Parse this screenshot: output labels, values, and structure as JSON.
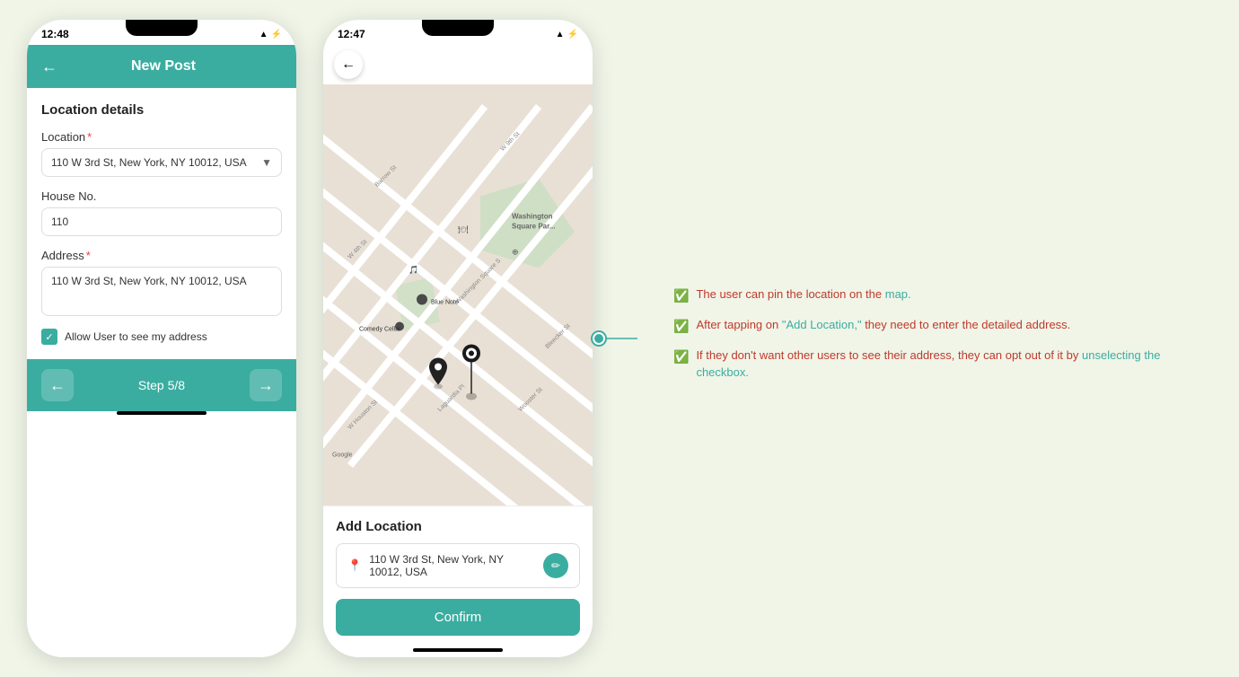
{
  "left_phone": {
    "time": "12:48",
    "header": {
      "back_label": "←",
      "title": "New Post"
    },
    "section_title": "Location details",
    "form": {
      "location_label": "Location",
      "location_value": "110 W 3rd St, New York, NY 10012, USA",
      "house_no_label": "House No.",
      "house_no_value": "110",
      "address_label": "Address",
      "address_value": "110 W 3rd St, New York, NY 10012, USA",
      "checkbox_label": "Allow User to see my address"
    },
    "footer": {
      "back_icon": "←",
      "step_label": "Step 5/8",
      "next_icon": "→"
    }
  },
  "right_phone": {
    "time": "12:47",
    "add_location": {
      "title": "Add Location",
      "address": "110 W 3rd St, New York, NY 10012, USA",
      "confirm_label": "Confirm"
    }
  },
  "annotations": {
    "items": [
      {
        "text": "The user can pin the location on the map.",
        "highlight_words": ""
      },
      {
        "text": "After tapping on \"Add Location,\" they need to enter the detailed address.",
        "highlight_words": ""
      },
      {
        "text": "If they don't want other users to see their address, they can opt out of it by unselecting the checkbox.",
        "highlight_words": ""
      }
    ]
  },
  "icons": {
    "back": "←",
    "next": "→",
    "check": "✓",
    "pin": "📍",
    "edit": "✏"
  }
}
